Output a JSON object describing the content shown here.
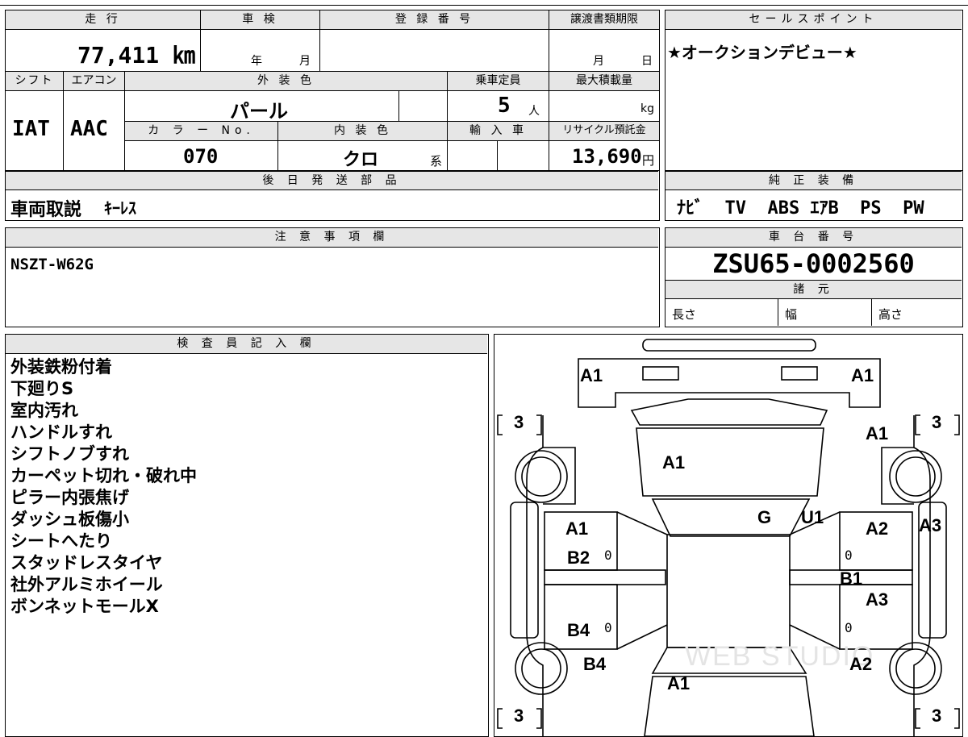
{
  "vehicle": {
    "mileage_header": "走 行",
    "mileage": "77,411 ㎞",
    "inspection_header": "車 検",
    "inspection_year_label": "年",
    "inspection_month_label": "月",
    "registration_header": "登 録 番 号",
    "transfer_header": "譲渡書類期限",
    "transfer_month_label": "月",
    "transfer_day_label": "日",
    "shift_header": "シフト",
    "shift": "IAT",
    "aircon_header": "エアコン",
    "aircon": "AAC",
    "exterior_color_header": "外 装 色",
    "exterior_color": "パール",
    "capacity_header": "乗車定員",
    "capacity": "5",
    "capacity_unit": "人",
    "max_load_header": "最大積載量",
    "max_load_unit": "kg",
    "color_no_header": "カ ラ ー No.",
    "color_no": "070",
    "interior_color_header": "内 装 色",
    "interior_color": "クロ",
    "interior_suffix": "系",
    "import_header": "輸 入 車",
    "recycle_header": "リサイクル預託金",
    "recycle_fee": "13,690",
    "recycle_unit": "円"
  },
  "sales_point": {
    "header": "セールスポイント",
    "text": "★オークションデビュー★"
  },
  "later_parts": {
    "header": "後 日 発 送 部 品",
    "text": "車両取説",
    "extra": "ｷｰﾚｽ"
  },
  "genuine_equipment": {
    "header": "純 正 装 備",
    "text": "ﾅﾋﾞ  TV  ABS ｴｱB  PS  PW"
  },
  "notes": {
    "header": "注 意 事 項 欄",
    "text": "NSZT-W62G"
  },
  "chassis": {
    "header": "車 台 番 号",
    "number": "ZSU65-0002560",
    "spec_header": "諸 元",
    "length_label": "長さ",
    "width_label": "幅",
    "height_label": "高さ"
  },
  "inspector": {
    "header": "検 査 員 記 入 欄",
    "remarks": [
      "外装鉄粉付着",
      "下廻りS",
      "室内汚れ",
      "ハンドルすれ",
      "シフトノブすれ",
      "カーペット切れ・破れ中",
      "ピラー内張焦げ",
      "ダッシュ板傷小",
      "シートへたり",
      "スタッドレスタイヤ",
      "社外アルミホイール",
      "ボンネットモールX"
    ]
  },
  "diagram": {
    "tire_tl": "3",
    "tire_tr": "3",
    "tire_bl": "3",
    "tire_br": "3",
    "front_left": "A1",
    "front_right": "A1",
    "hood": "A1",
    "fender_right_front": "A1",
    "windshield": "G",
    "pillar_right": "U1",
    "door_left_front": "A1",
    "door_left_front_2": "B2",
    "door_right_front": "A2",
    "step_right": "A3",
    "sill_right": "B1",
    "door_right_rear": "A3",
    "door_left_rear": "B4",
    "quarter_left": "B4",
    "quarter_right": "A2",
    "rear": "A1",
    "zero": "0",
    "watermark": "WEB STUDIO"
  }
}
